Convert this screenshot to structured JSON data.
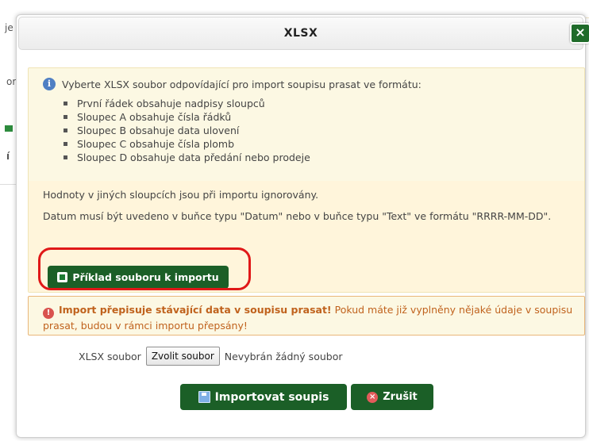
{
  "background": {
    "fragments": [
      "je",
      "or",
      "í"
    ]
  },
  "dialog": {
    "title": "XLSX",
    "close_label": "×",
    "info": {
      "icon": "info-icon",
      "intro": "Vyberte XLSX soubor odpovídající pro import soupisu prasat ve formátu:",
      "bullets": [
        "První řádek obsahuje nadpisy sloupců",
        "Sloupec A obsahuje čísla řádků",
        "Sloupec B obsahuje data ulovení",
        "Sloupec C obsahuje čísla plomb",
        "Sloupec D obsahuje data předání nebo prodeje"
      ],
      "note_ignored": "Hodnoty v jiných sloupcích jsou při importu ignorovány.",
      "note_date": "Datum musí být uvedeno v buňce typu \"Datum\" nebo v buňce typu \"Text\" ve formátu \"RRRR-MM-DD\".",
      "example_button": "Příklad souboru k importu"
    },
    "warning": {
      "icon": "warning-icon",
      "strong": "Import přepisuje stávající data v soupisu prasat!",
      "text": "Pokud máte již vyplněny nějaké údaje v soupisu prasat, budou v rámci importu přepsány!"
    },
    "file": {
      "label": "XLSX soubor",
      "choose_button": "Zvolit soubor",
      "status": "Nevybrán žádný soubor"
    },
    "actions": {
      "import_label": "Importovat soupis",
      "cancel_label": "Zrušit"
    }
  },
  "colors": {
    "button_green": "#1b5f27",
    "info_bg": "#fcf8e3",
    "warning_text": "#c0621d",
    "highlight": "#e01818"
  }
}
